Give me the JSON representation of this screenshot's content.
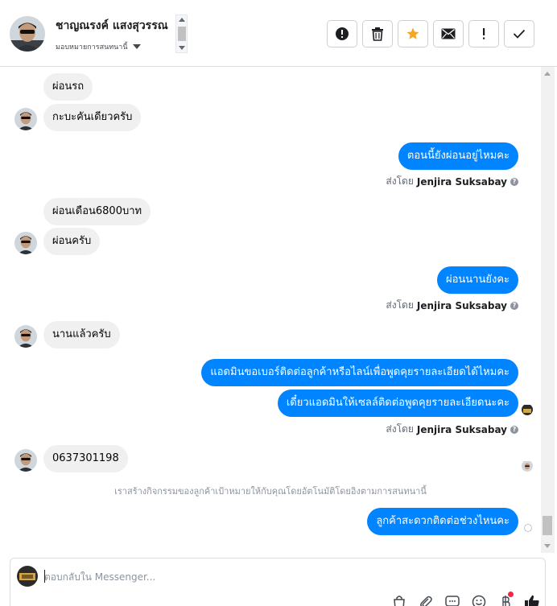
{
  "header": {
    "contact_name": "ชาญณรงค์ แสงสุวรรณ",
    "assign_label": "มอบหมายการสนทนานี้",
    "actions": [
      {
        "name": "spam-button",
        "icon": "alert-circle-icon"
      },
      {
        "name": "delete-button",
        "icon": "trash-icon"
      },
      {
        "name": "star-button",
        "icon": "star-icon",
        "color": "#f5a623"
      },
      {
        "name": "mark-unread-button",
        "icon": "envelope-icon"
      },
      {
        "name": "follow-up-button",
        "icon": "exclamation-icon"
      },
      {
        "name": "mark-done-button",
        "icon": "check-icon"
      }
    ]
  },
  "messages": [
    {
      "dir": "in",
      "text": "ผ่อนรถ"
    },
    {
      "dir": "in",
      "text": "กะบะคันเดียวครับ"
    },
    {
      "dir": "out",
      "text": "ตอนนี้ยังผ่อนอยู่ไหมคะ"
    },
    {
      "dir": "in",
      "text": "ผ่อนเดือน6800บาท"
    },
    {
      "dir": "in",
      "text": "ผ่อนครับ"
    },
    {
      "dir": "out",
      "text": "ผ่อนนานยังคะ"
    },
    {
      "dir": "in",
      "text": "นานแล้วครับ"
    },
    {
      "dir": "out",
      "text": "แอดมินขอเบอร์ติดต่อลูกค้าหรือไลน์เพื่อพูดคุยรายละเอียดได้ไหมคะ"
    },
    {
      "dir": "out",
      "text": "เดี๋ยวแอดมินให้เซลล์ติดต่อพูดคุยรายละเอียดนะคะ"
    },
    {
      "dir": "in",
      "text": "0637301198"
    },
    {
      "dir": "out",
      "text": "ลูกค้าสะดวกติดต่อช่วงไหนคะ"
    }
  ],
  "sent_by": {
    "prefix": "ส่งโดย",
    "agent": "Jenjira Suksabay",
    "info_glyph": "?"
  },
  "system_note": "เราสร้างกิจกรรมของลูกค้าเป้าหมายให้กับคุณโดยอัตโนมัติโดยอิงตามการสนทนานี้",
  "composer": {
    "placeholder": "ตอบกลับใน Messenger...",
    "value": "",
    "tools": [
      "shopping-bag-icon",
      "paperclip-icon",
      "saved-reply-icon",
      "emoji-icon",
      "baht-icon",
      "thumbs-up-icon"
    ]
  },
  "colors": {
    "outgoing_bubble": "#0084ff",
    "incoming_bubble": "#f0f0f0",
    "star": "#f5a623",
    "notification": "#f02849"
  }
}
